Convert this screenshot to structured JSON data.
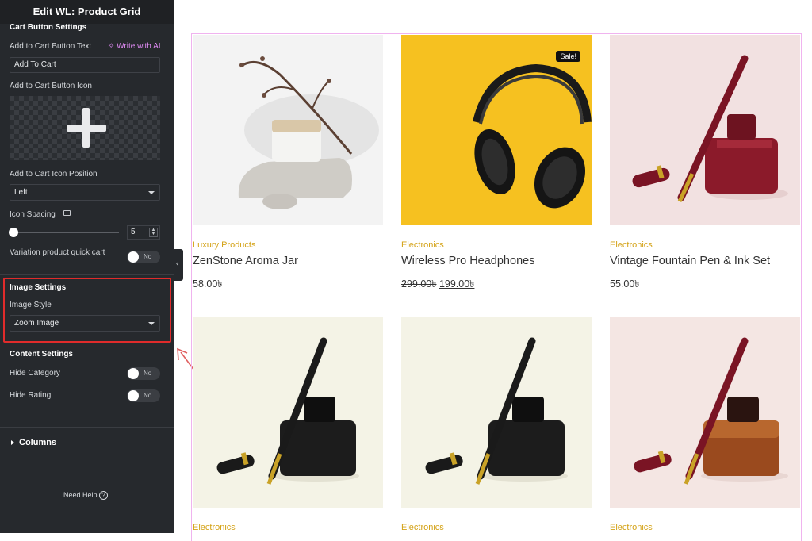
{
  "panel": {
    "title": "Edit WL: Product Grid",
    "cart_button_section": "Cart Button Settings",
    "cart_text_label": "Add to Cart Button Text",
    "write_ai": "✧ Write with AI",
    "cart_text_value": "Add To Cart",
    "cart_icon_label": "Add to Cart Button Icon",
    "icon_position_label": "Add to Cart Icon Position",
    "icon_position_value": "Left",
    "icon_spacing_label": "Icon Spacing",
    "icon_spacing_value": "5",
    "icon_spacing_fraction": 0.0,
    "variation_label": "Variation product quick cart",
    "variation_toggle": "No",
    "image_section": "Image Settings",
    "image_style_label": "Image Style",
    "image_style_value": "Zoom Image",
    "content_section": "Content Settings",
    "hide_category_label": "Hide Category",
    "hide_category_toggle": "No",
    "hide_rating_label": "Hide Rating",
    "hide_rating_toggle": "No",
    "columns_label": "Columns",
    "need_help": "Need Help",
    "help_glyph": "?",
    "collapse_glyph": "‹"
  },
  "products": [
    {
      "category": "Luxury Products",
      "name": "ZenStone Aroma Jar",
      "price": "58.00৳",
      "bg": "#f3f3f3"
    },
    {
      "category": "Electronics",
      "name": "Wireless Pro Headphones",
      "old_price": "299.00৳",
      "new_price": "199.00৳",
      "badge": "Sale!",
      "bg": "#f6c120"
    },
    {
      "category": "Electronics",
      "name": "Vintage Fountain Pen & Ink Set",
      "price": "55.00৳",
      "bg": "#f2e1e1"
    },
    {
      "category": "Electronics",
      "bg": "#f4f3e6"
    },
    {
      "category": "Electronics",
      "bg": "#f4f3e6"
    },
    {
      "category": "Electronics",
      "bg": "#f4e6e3"
    }
  ],
  "colors": {
    "panel_bg": "#26292d",
    "accent_ai": "#e28cf6",
    "highlight": "#e02b2b",
    "category": "#d4a216"
  }
}
